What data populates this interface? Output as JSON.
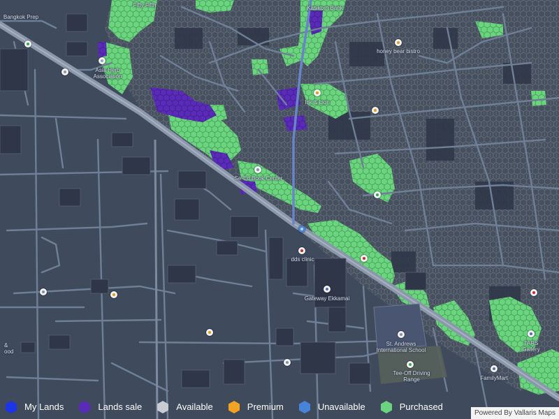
{
  "map": {
    "attribution": "Powered By Vallaris Maps",
    "colors": {
      "background": "#3f4a5c",
      "minor_road": "#6f7f98",
      "major_road": "#8b97ab",
      "building": "#2e3647",
      "hex_fill": "#47505e",
      "hex_stroke": "#707986",
      "purchased": "#6ad47e",
      "lands_sale": "#5a2ab8",
      "my_lands": "#1c35e8",
      "unavailable": "#4784d8"
    },
    "poi_labels": [
      {
        "id": "bangkok-prep",
        "text": "Bangkok Prep"
      },
      {
        "id": "fifty-fifth",
        "text": "Fifty Fifth"
      },
      {
        "id": "kasikorn-bank",
        "text": "Kasikorn Bank"
      },
      {
        "id": "honey-bear-bistro",
        "text": "honey bear bistro"
      },
      {
        "id": "asia-herb-association",
        "text": "Asia Herb\nAssociation"
      },
      {
        "id": "ink-and-lion",
        "text": "Ink & Lion"
      },
      {
        "id": "se-ed-book-center",
        "text": "Se-Ed Book Center"
      },
      {
        "id": "dds-clinic",
        "text": "dds clinic"
      },
      {
        "id": "gateway-ekkamai",
        "text": "Gateway Ekkamai"
      },
      {
        "id": "st-andrews",
        "text": "St. Andrews\nInternational School"
      },
      {
        "id": "tee-off-driving-range",
        "text": "Tee-Off Driving\nRange"
      },
      {
        "id": "tars-gallery",
        "text": "TARS Gallery"
      },
      {
        "id": "familymart",
        "text": "FamilyMart"
      },
      {
        "id": "food-partial",
        "text": "&\nood"
      }
    ]
  },
  "legend": [
    {
      "key": "my-lands",
      "label": "My Lands",
      "color": "#1c35e8"
    },
    {
      "key": "lands-sale",
      "label": "Lands sale",
      "color": "#5a2ab8"
    },
    {
      "key": "available",
      "label": "Available",
      "color": "#c9cdd3"
    },
    {
      "key": "premium",
      "label": "Premium",
      "color": "#f1a321"
    },
    {
      "key": "unavailable",
      "label": "Unavailable",
      "color": "#4784d8"
    },
    {
      "key": "purchased",
      "label": "Purchased",
      "color": "#6ad47e"
    }
  ]
}
